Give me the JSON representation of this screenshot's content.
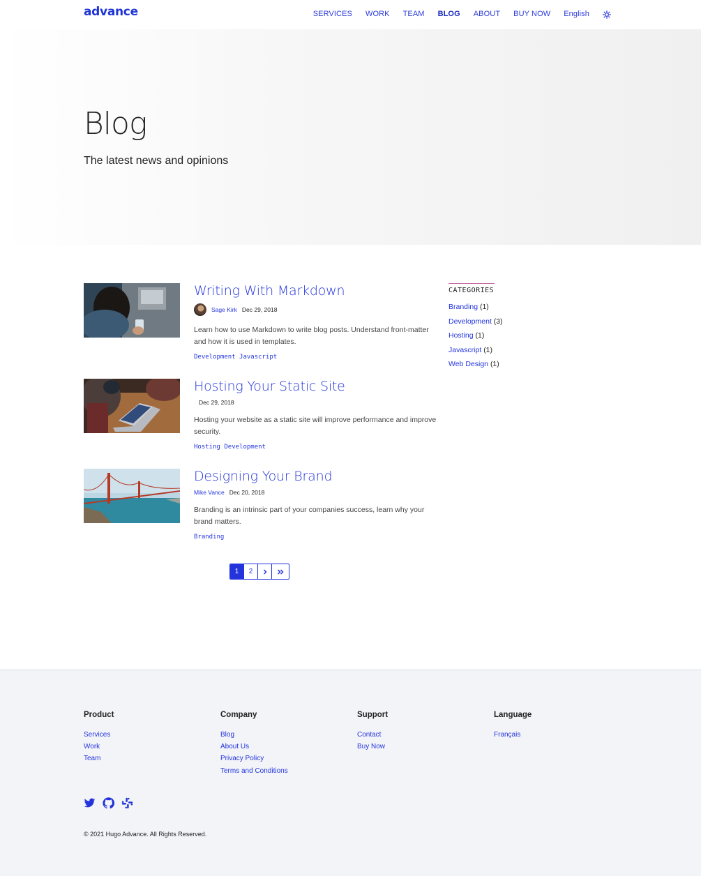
{
  "header": {
    "logo": "advance",
    "nav": [
      {
        "label": "SERVICES"
      },
      {
        "label": "WORK"
      },
      {
        "label": "TEAM"
      },
      {
        "label": "BLOG",
        "active": true
      },
      {
        "label": "ABOUT"
      },
      {
        "label": "BUY NOW"
      }
    ],
    "language": "English",
    "theme_icon": "theme-toggle-icon"
  },
  "hero": {
    "title": "Blog",
    "subtitle": "The latest news and opinions"
  },
  "posts": [
    {
      "title": "Writing With Markdown",
      "author": "Sage Kirk",
      "date": "Dec 29, 2018",
      "excerpt": "Learn how to use Markdown to write blog posts. Understand front-matter and how it is used in templates.",
      "tags": [
        "Development",
        "Javascript"
      ]
    },
    {
      "title": "Hosting Your Static Site",
      "author": "",
      "date": "Dec 29, 2018",
      "excerpt": "Hosting your website as a static site will improve performance and improve security.",
      "tags": [
        "Hosting",
        "Development"
      ]
    },
    {
      "title": "Designing Your Brand",
      "author": "Mike Vance",
      "date": "Dec 20, 2018",
      "excerpt": "Branding is an intrinsic part of your companies success, learn why your brand matters.",
      "tags": [
        "Branding"
      ]
    }
  ],
  "pagination": {
    "pages": [
      "1",
      "2"
    ],
    "current": "1",
    "next_icon": "chevron-right-icon",
    "last_icon": "double-chevron-right-icon"
  },
  "sidebar": {
    "heading": "CATEGORIES",
    "categories": [
      {
        "name": "Branding",
        "count": "(1)"
      },
      {
        "name": "Development",
        "count": "(3)"
      },
      {
        "name": "Hosting",
        "count": "(1)"
      },
      {
        "name": "Javascript",
        "count": "(1)"
      },
      {
        "name": "Web Design",
        "count": "(1)"
      }
    ]
  },
  "footer": {
    "columns": [
      {
        "title": "Product",
        "links": [
          "Services",
          "Work",
          "Team"
        ]
      },
      {
        "title": "Company",
        "links": [
          "Blog",
          "About Us",
          "Privacy Policy",
          "Terms and Conditions"
        ]
      },
      {
        "title": "Support",
        "links": [
          "Contact",
          "Buy Now"
        ]
      },
      {
        "title": "Language",
        "links": [
          "Français"
        ]
      }
    ],
    "social": [
      "twitter-icon",
      "github-icon",
      "slack-icon"
    ],
    "copyright": "© 2021 Hugo Advance. All Rights Reserved."
  },
  "colors": {
    "accent": "#2334dc",
    "hero_bg": "#f3f3f3",
    "footer_bg": "#f3f4f8",
    "category_rule": "#c86aa3"
  }
}
